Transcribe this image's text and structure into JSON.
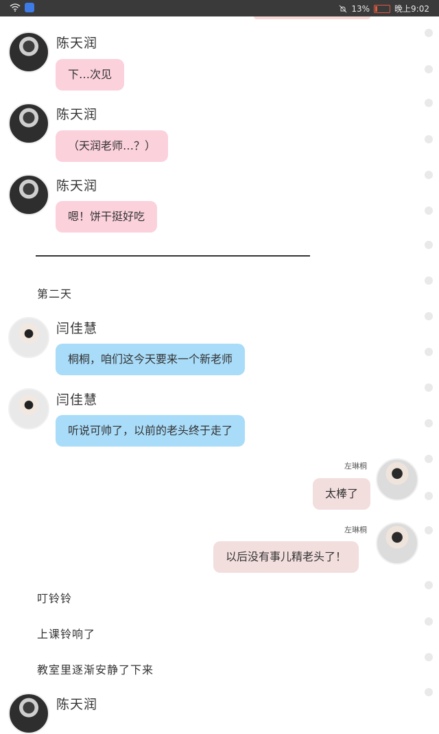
{
  "status_bar": {
    "wifi_icon": "wifi-icon",
    "battery_percent": "13%",
    "battery_level": 0.13,
    "time": "晚上9:02"
  },
  "messages": [
    {
      "name": "陈天润",
      "text": "下…次见"
    },
    {
      "name": "陈天润",
      "text": "（天润老师…？）"
    },
    {
      "name": "陈天润",
      "text": "嗯！饼干挺好吃"
    },
    {
      "name": "闫佳慧",
      "text": "桐桐，咱们这今天要来一个新老师"
    },
    {
      "name": "闫佳慧",
      "text": "听说可帅了，以前的老头终于走了"
    },
    {
      "name": "左琳桐",
      "text": "太棒了"
    },
    {
      "name": "左琳桐",
      "text": "以后没有事儿精老头了！"
    },
    {
      "name": "陈天润"
    }
  ],
  "narration": {
    "day": "第二天",
    "line1": "叮铃铃",
    "line2": "上课铃响了",
    "line3": "教室里逐渐安静了下来"
  },
  "colors": {
    "pink_bubble": "#fbd1dc",
    "blue_bubble": "#a9dcf9",
    "rose_bubble": "#f3dede",
    "status_bar": "#3a3a3a"
  }
}
